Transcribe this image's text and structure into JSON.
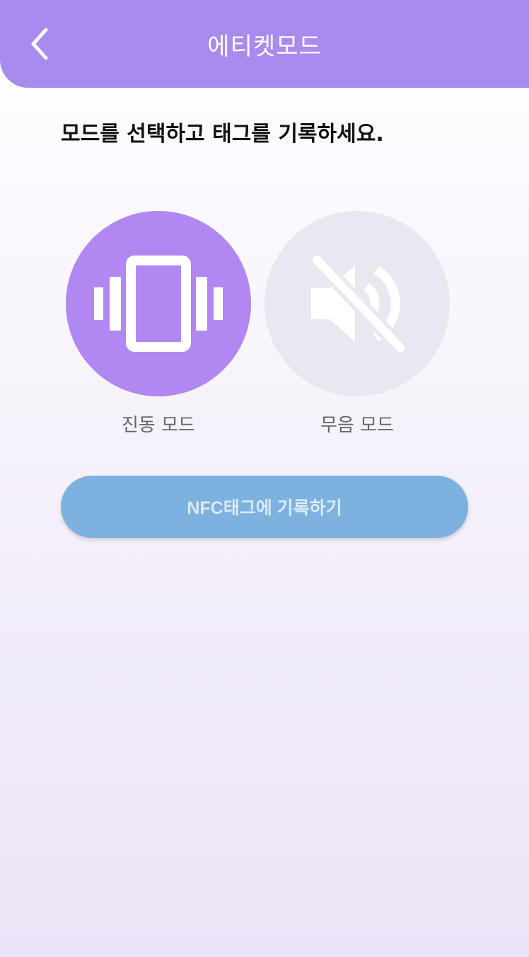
{
  "header": {
    "title": "에티켓모드",
    "back_icon": "chevron-left-icon"
  },
  "instruction": "모드를 선택하고 태그를 기록하세요.",
  "modes": [
    {
      "label": "진동 모드",
      "icon": "vibrate-phone-icon",
      "selected": true,
      "color": "#b187f2"
    },
    {
      "label": "무음 모드",
      "icon": "volume-off-icon",
      "selected": false,
      "color": "#e9e8f0"
    }
  ],
  "nfc_button": {
    "label": "NFC태그에 기록하기",
    "color": "#7db2df"
  },
  "colors": {
    "header": "#a98aee",
    "accent": "#b187f2"
  }
}
